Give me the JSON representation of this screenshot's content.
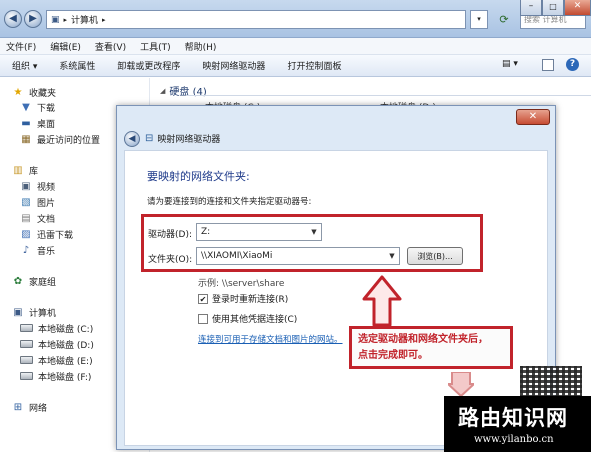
{
  "explorer": {
    "address_root": "计算机",
    "search_placeholder": "搜索 计算机",
    "menu": [
      "文件(F)",
      "编辑(E)",
      "查看(V)",
      "工具(T)",
      "帮助(H)"
    ],
    "toolbar": [
      "组织 ▾",
      "系统属性",
      "卸载或更改程序",
      "映射网络驱动器",
      "打开控制面板"
    ]
  },
  "sidebar": {
    "favorites": {
      "label": "收藏夹",
      "items": [
        "下载",
        "桌面",
        "最近访问的位置"
      ]
    },
    "libraries": {
      "label": "库",
      "items": [
        "视频",
        "图片",
        "文档",
        "迅雷下载",
        "音乐"
      ]
    },
    "homegroup": "家庭组",
    "computer": {
      "label": "计算机",
      "drives": [
        "本地磁盘 (C:)",
        "本地磁盘 (D:)",
        "本地磁盘 (E:)",
        "本地磁盘 (F:)"
      ]
    },
    "network": "网络"
  },
  "content": {
    "section_title": "硬盘 (4)",
    "drive_labels": [
      "本地磁盘 (C:)",
      "本地磁盘 (D:)"
    ]
  },
  "dialog": {
    "title": "映射网络驱动器",
    "heading": "要映射的网络文件夹:",
    "instruction": "请为要连接到的连接和文件夹指定驱动器号:",
    "drive_label": "驱动器(D):",
    "drive_value": "Z:",
    "folder_label": "文件夹(O):",
    "folder_value": "\\\\XIAOMI\\XiaoMi",
    "browse_button": "浏览(B)...",
    "example": "示例: \\\\server\\share",
    "reconnect_label": "登录时重新连接(R)",
    "reconnect_checked": true,
    "other_credentials_label": "使用其他凭据连接(C)",
    "other_credentials_checked": false,
    "link": "连接到可用于存储文档和图片的网站。"
  },
  "annotation": {
    "line1": "选定驱动器和网络文件夹后，",
    "line2": "点击完成即可。"
  },
  "watermark": {
    "title": "路由知识网",
    "url": "www.yilanbo.cn"
  },
  "colors": {
    "annotation_red": "#c1232b",
    "link_blue": "#1a5fb4"
  }
}
